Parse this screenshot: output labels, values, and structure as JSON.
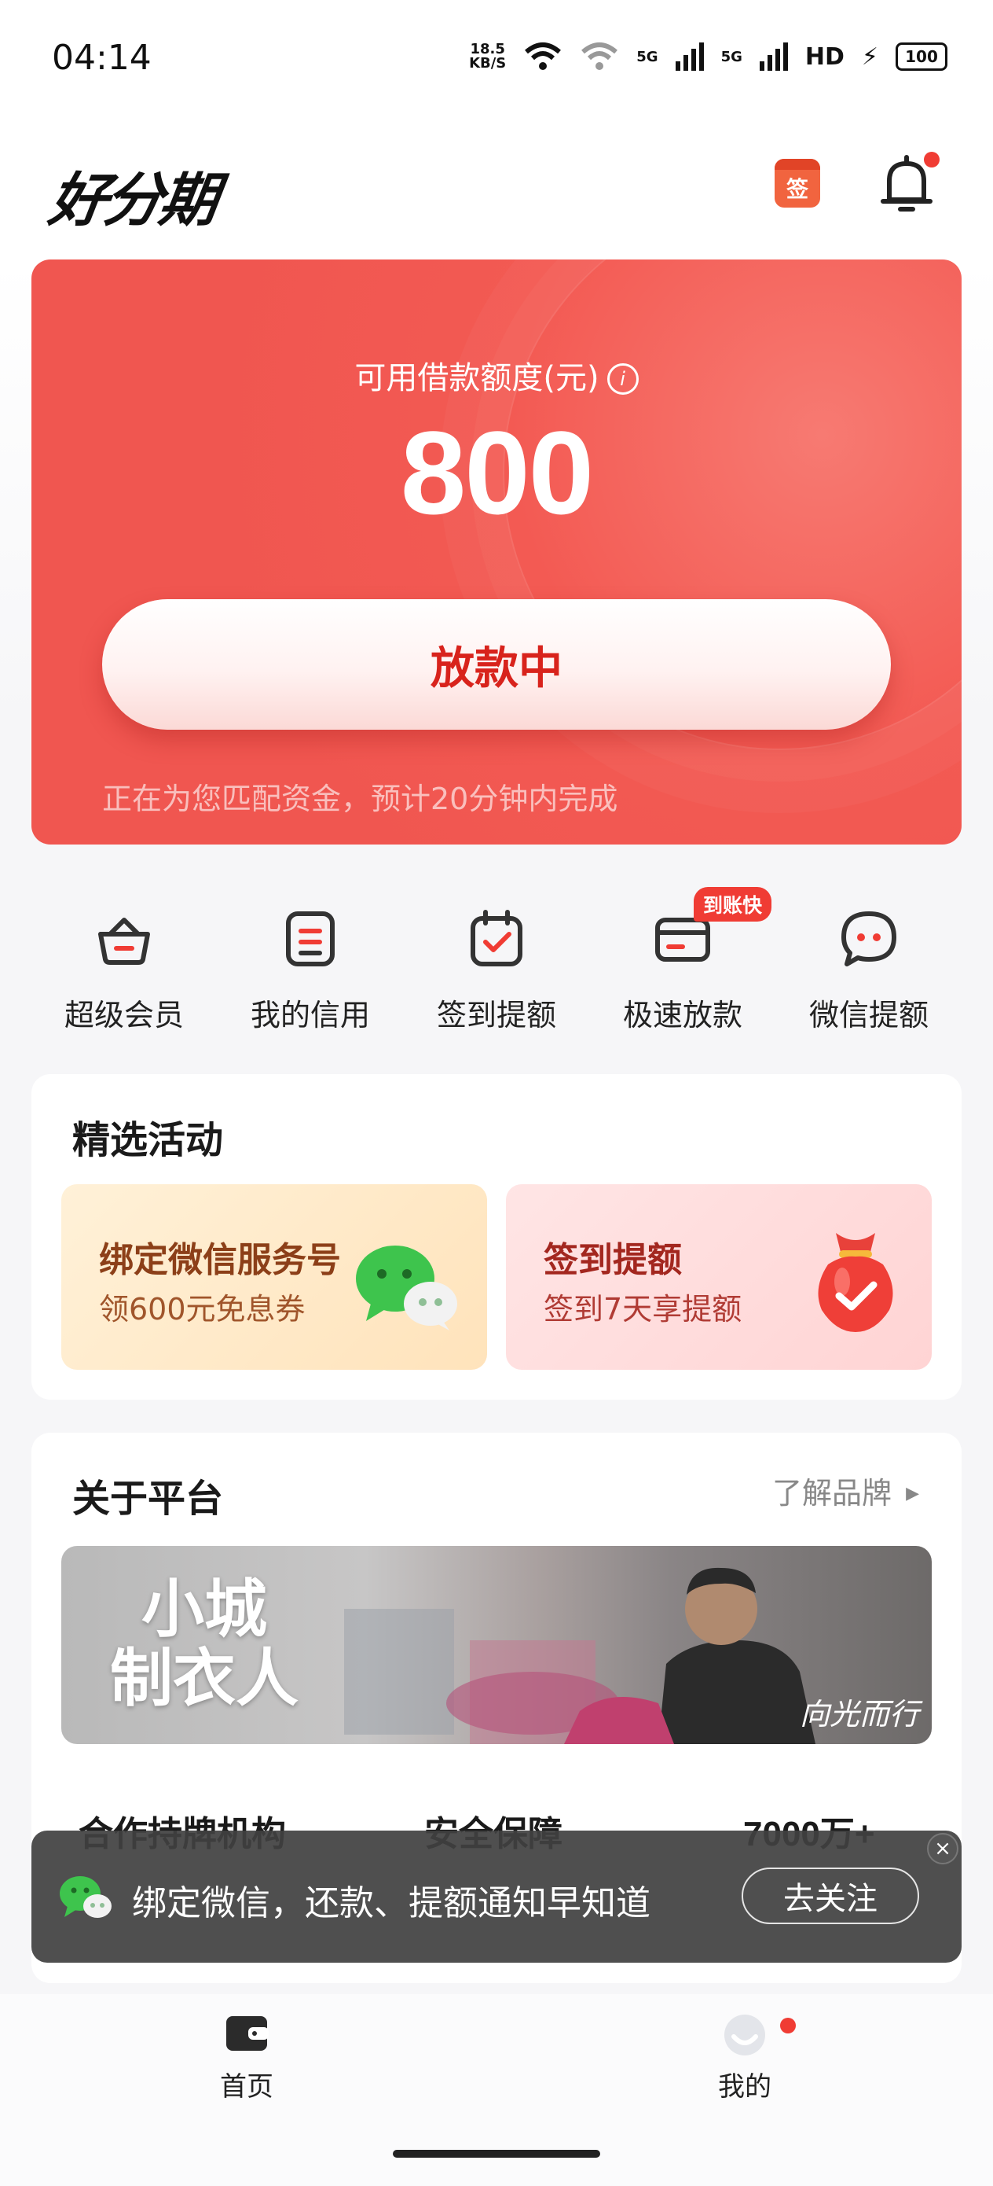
{
  "status_bar": {
    "time": "04:14",
    "net_speed_value": "18.5",
    "net_speed_unit": "KB/S",
    "signal_1": "5G",
    "signal_2": "5G",
    "hd": "HD",
    "battery": "100"
  },
  "header": {
    "logo": "好分期",
    "sign_icon_text": "签",
    "icons": [
      "sign-calendar-icon",
      "bell-icon"
    ]
  },
  "credit": {
    "label": "可用借款额度(元)",
    "info_icon": "i",
    "amount": "800",
    "button_label": "放款中",
    "status_text": "正在为您匹配资金，预计20分钟内完成"
  },
  "quick_menu": [
    {
      "label": "超级会员",
      "icon": "basket-icon"
    },
    {
      "label": "我的信用",
      "icon": "credit-doc-icon"
    },
    {
      "label": "签到提额",
      "icon": "calendar-check-icon"
    },
    {
      "label": "极速放款",
      "icon": "card-icon",
      "badge": "到账快"
    },
    {
      "label": "微信提额",
      "icon": "chat-bubble-icon"
    }
  ],
  "activities": {
    "title": "精选活动",
    "cards": [
      {
        "title": "绑定微信服务号",
        "subtitle": "领600元免息券",
        "icon": "wechat-icon"
      },
      {
        "title": "签到提额",
        "subtitle": "签到7天享提额",
        "icon": "lucky-bag-icon"
      }
    ]
  },
  "about": {
    "title": "关于平台",
    "link": "了解品牌",
    "banner_title_1": "小城",
    "banner_title_2": "制衣人",
    "banner_signature": "向光而行",
    "stats": [
      "合作持牌机构",
      "安全保障",
      "7000万+"
    ]
  },
  "toast": {
    "text": "绑定微信，还款、提额通知早知道",
    "button": "去关注",
    "close": "×"
  },
  "bottom_nav": [
    {
      "label": "首页",
      "icon": "wallet-icon"
    },
    {
      "label": "我的",
      "icon": "profile-icon"
    }
  ],
  "colors": {
    "accent": "#f05650",
    "badge": "#f03c34",
    "wechat": "#3ec44d"
  }
}
